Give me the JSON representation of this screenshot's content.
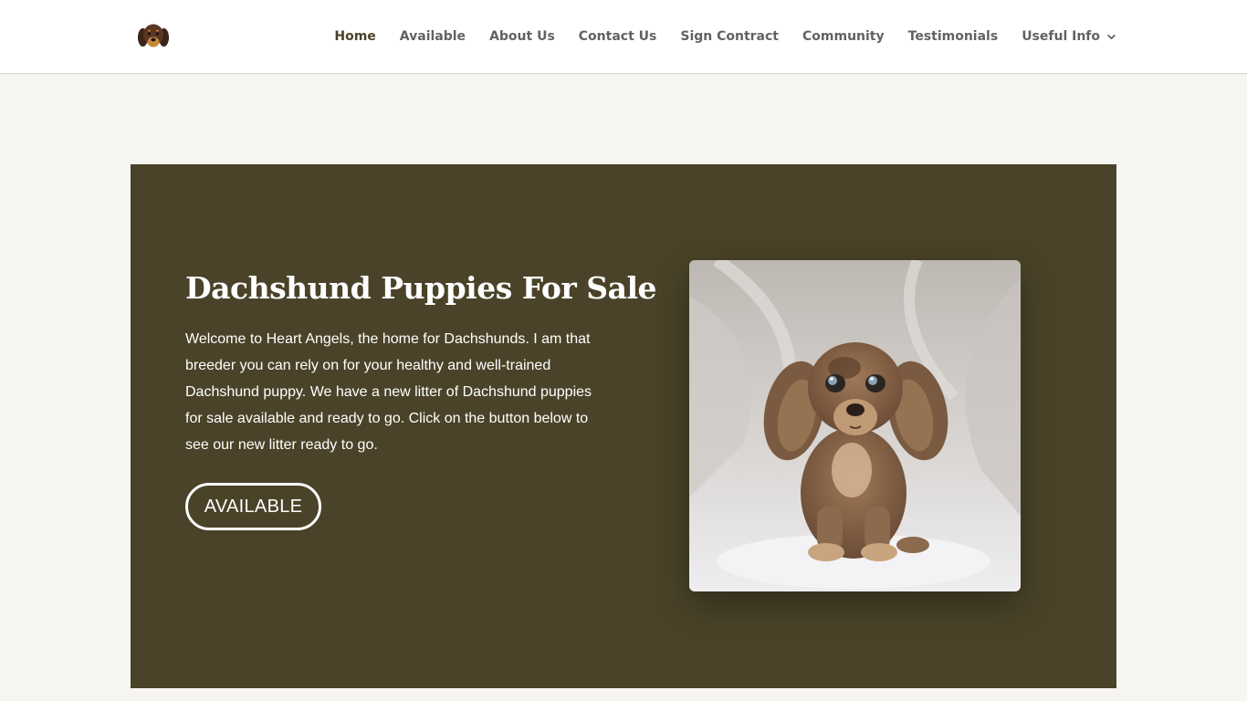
{
  "header": {
    "logo_icon": "dachshund-head-icon",
    "nav": [
      {
        "label": "Home",
        "active": true
      },
      {
        "label": "Available"
      },
      {
        "label": "About Us"
      },
      {
        "label": "Contact Us"
      },
      {
        "label": "Sign Contract"
      },
      {
        "label": "Community"
      },
      {
        "label": "Testimonials"
      },
      {
        "label": "Useful Info",
        "has_dropdown": true,
        "icon": "chevron-down-icon"
      }
    ]
  },
  "hero": {
    "title": "Dachshund Puppies For Sale",
    "text": "Welcome to Heart Angels, the home for Dachshunds. I am that breeder you can rely on for your healthy and well-trained Dachshund puppy. We have a new litter of Dachshund puppies for sale available and ready to go. Click on the button below to see our new litter ready to go.",
    "button_label": "AVAILABLE",
    "image_icon": "dachshund-puppy-photo"
  },
  "colors": {
    "hero_background": "#4a4329",
    "page_background": "#f6f5f2",
    "header_background": "#ffffff",
    "nav_active": "#4a4329"
  }
}
